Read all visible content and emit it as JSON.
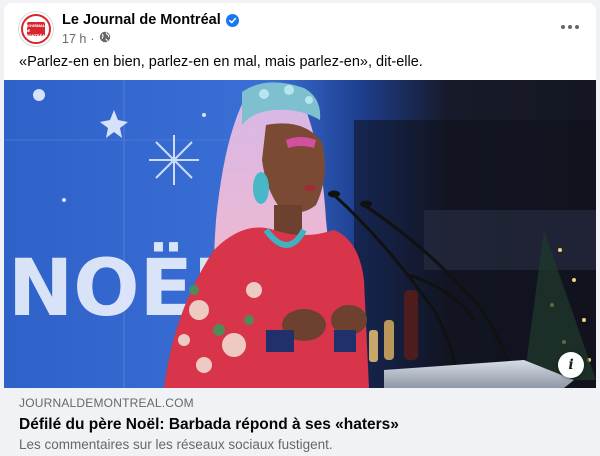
{
  "post": {
    "page_name": "Le Journal de Montréal",
    "time": "17 h",
    "separator": "·",
    "caption": "«Parlez-en en bien, parlez-en en mal, mais parlez-en», dit-elle.",
    "verified_icon": "verified-badge-icon",
    "audience_icon": "globe-icon",
    "more_icon": "more-options-icon",
    "avatar_logo_lines": [
      "LE",
      "JOURNAL",
      "DE MONTRÉAL"
    ]
  },
  "photo": {
    "sign_text": "NOËL",
    "info_label": "i"
  },
  "link_preview": {
    "domain": "JOURNALDEMONTREAL.COM",
    "title": "Défilé du père Noël: Barbada répond à ses «haters»",
    "description": "Les commentaires sur les réseaux sociaux fustigent."
  },
  "colors": {
    "brand_red": "#d8262e",
    "verified_blue": "#1877f2",
    "secondary_text": "#65676b",
    "link_bg": "#f0f2f5"
  }
}
